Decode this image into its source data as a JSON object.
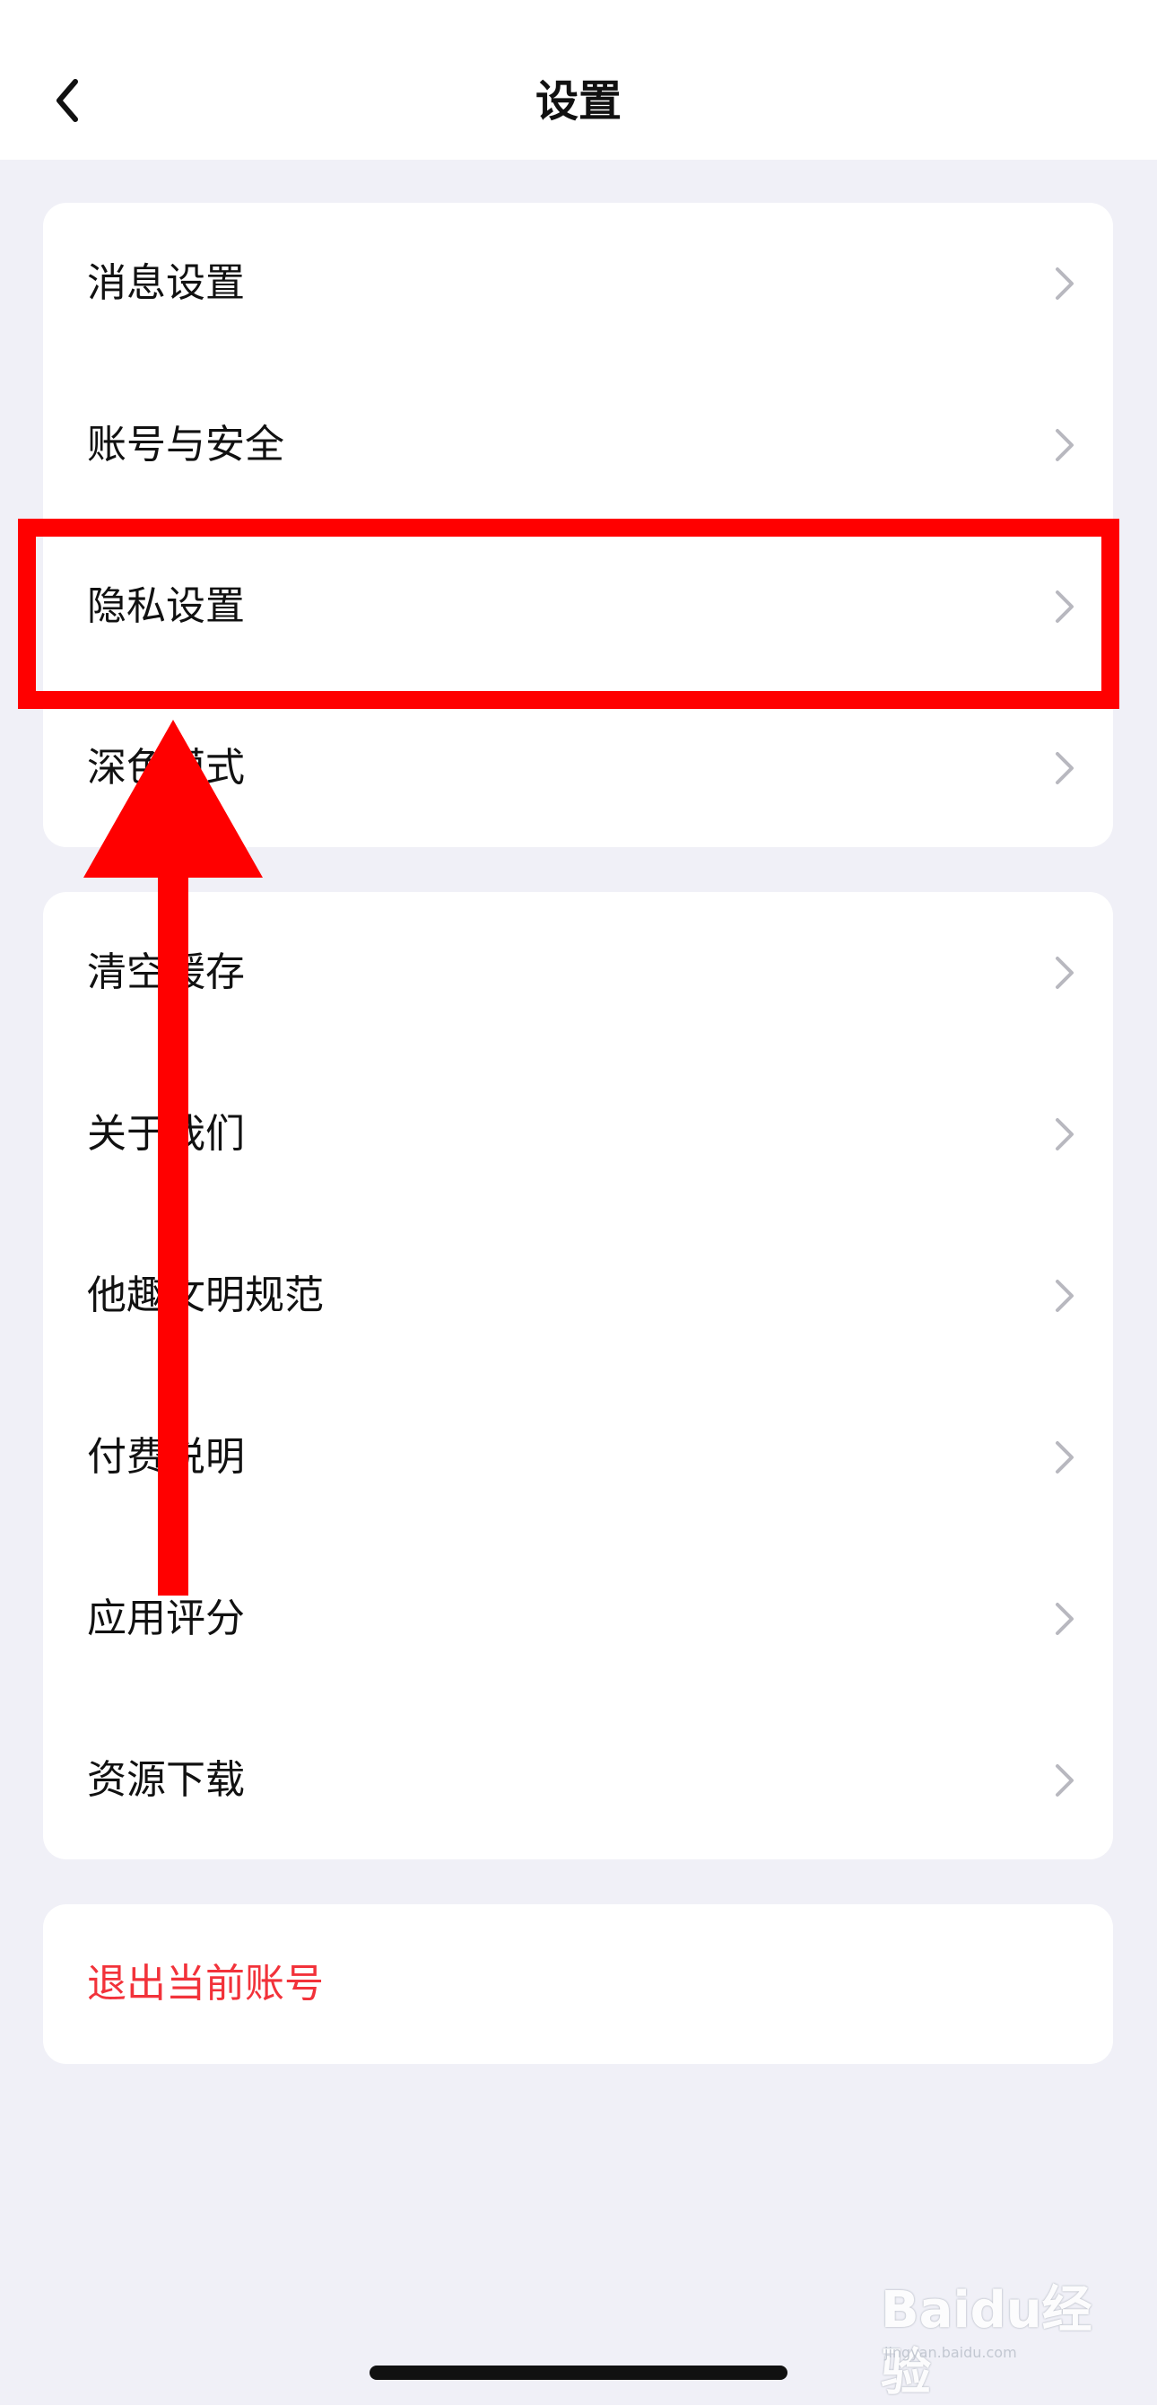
{
  "header": {
    "title": "设置",
    "back_icon": "chevron-left-icon"
  },
  "group1": {
    "items": [
      {
        "label": "消息设置"
      },
      {
        "label": "账号与安全"
      },
      {
        "label": "隐私设置"
      },
      {
        "label": "深色模式"
      }
    ]
  },
  "group2": {
    "items": [
      {
        "label": "清空缓存"
      },
      {
        "label": "关于我们"
      },
      {
        "label": "他趣文明规范"
      },
      {
        "label": "付费说明"
      },
      {
        "label": "应用评分"
      },
      {
        "label": "资源下载"
      }
    ]
  },
  "logout": {
    "label": "退出当前账号"
  },
  "watermark": {
    "text": "Baidu经验",
    "sub": "jingyan.baidu.com"
  },
  "colors": {
    "background": "#f0f0f7",
    "card": "#ffffff",
    "logout_text": "#f2323a",
    "annotation": "#ff0000",
    "chevron": "#b8b8bf"
  }
}
